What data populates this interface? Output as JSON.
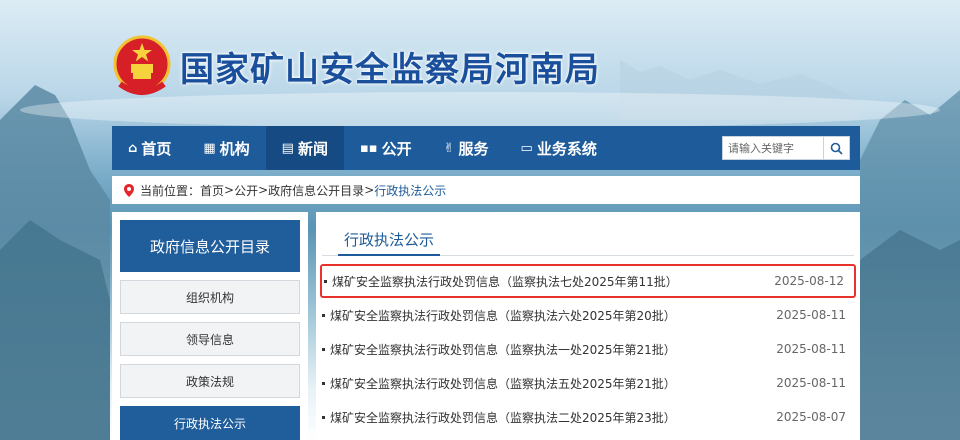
{
  "header": {
    "site_title": "国家矿山安全监察局河南局"
  },
  "nav": {
    "items": [
      {
        "label": "首页",
        "icon": "home-icon"
      },
      {
        "label": "机构",
        "icon": "building-icon"
      },
      {
        "label": "新闻",
        "icon": "document-icon",
        "active": true
      },
      {
        "label": "公开",
        "icon": "grid-icon"
      },
      {
        "label": "服务",
        "icon": "handshake-icon"
      },
      {
        "label": "业务系统",
        "icon": "monitor-icon"
      }
    ],
    "search_placeholder": "请输入关键字"
  },
  "breadcrumb": {
    "prefix": "当前位置：",
    "items": [
      "首页",
      "公开",
      "政府信息公开目录",
      "行政执法公示"
    ],
    "separator": ">"
  },
  "sidebar": {
    "heading": "政府信息公开目录",
    "items": [
      {
        "label": "组织机构"
      },
      {
        "label": "领导信息"
      },
      {
        "label": "政策法规"
      },
      {
        "label": "行政执法公示",
        "active": true
      }
    ]
  },
  "main": {
    "section_title": "行政执法公示",
    "articles": [
      {
        "title": "煤矿安全监察执法行政处罚信息（监察执法七处2025年第11批）",
        "date": "2025-08-12",
        "highlighted": true
      },
      {
        "title": "煤矿安全监察执法行政处罚信息（监察执法六处2025年第20批）",
        "date": "2025-08-11"
      },
      {
        "title": "煤矿安全监察执法行政处罚信息（监察执法一处2025年第21批）",
        "date": "2025-08-11"
      },
      {
        "title": "煤矿安全监察执法行政处罚信息（监察执法五处2025年第21批）",
        "date": "2025-08-11"
      },
      {
        "title": "煤矿安全监察执法行政处罚信息（监察执法二处2025年第23批）",
        "date": "2025-08-07"
      }
    ]
  },
  "colors": {
    "nav_blue": "#1e5b9a",
    "highlight_red": "#e8332c",
    "title_blue": "#1a4f9c"
  }
}
